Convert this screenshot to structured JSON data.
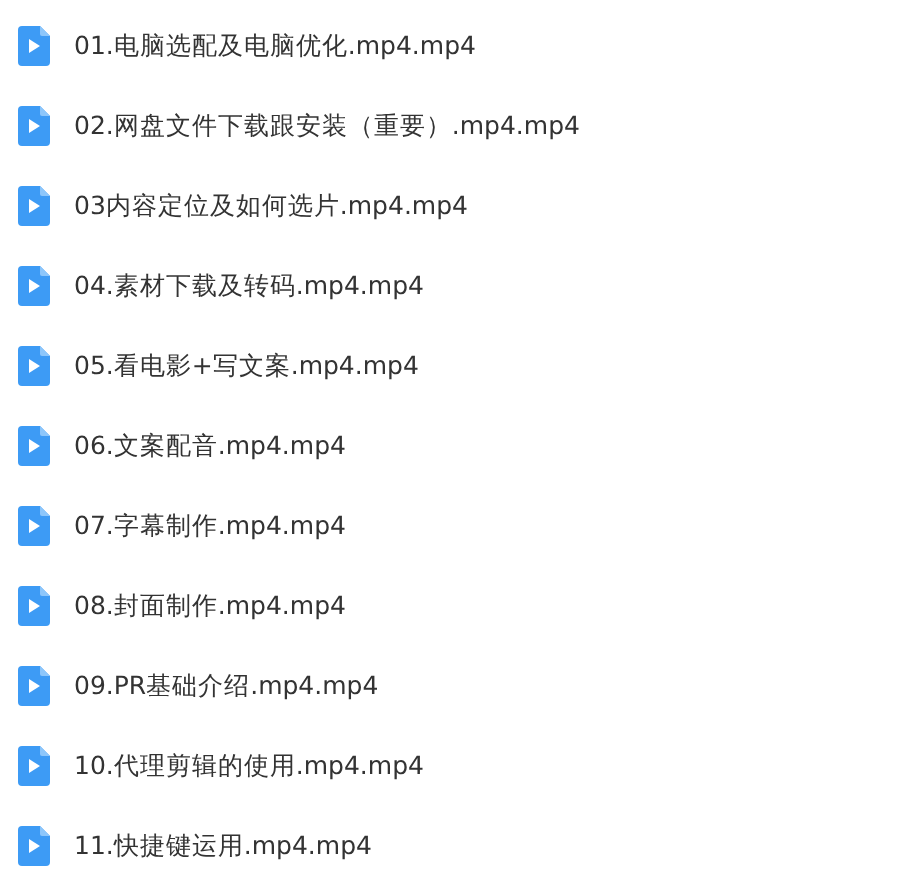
{
  "files": [
    {
      "name": "01.电脑选配及电脑优化.mp4.mp4"
    },
    {
      "name": "02.网盘文件下载跟安装（重要）.mp4.mp4"
    },
    {
      "name": "03内容定位及如何选片.mp4.mp4"
    },
    {
      "name": "04.素材下载及转码.mp4.mp4"
    },
    {
      "name": "05.看电影+写文案.mp4.mp4"
    },
    {
      "name": "06.文案配音.mp4.mp4"
    },
    {
      "name": "07.字幕制作.mp4.mp4"
    },
    {
      "name": "08.封面制作.mp4.mp4"
    },
    {
      "name": "09.PR基础介绍.mp4.mp4"
    },
    {
      "name": "10.代理剪辑的使用.mp4.mp4"
    },
    {
      "name": "11.快捷键运用.mp4.mp4"
    }
  ]
}
